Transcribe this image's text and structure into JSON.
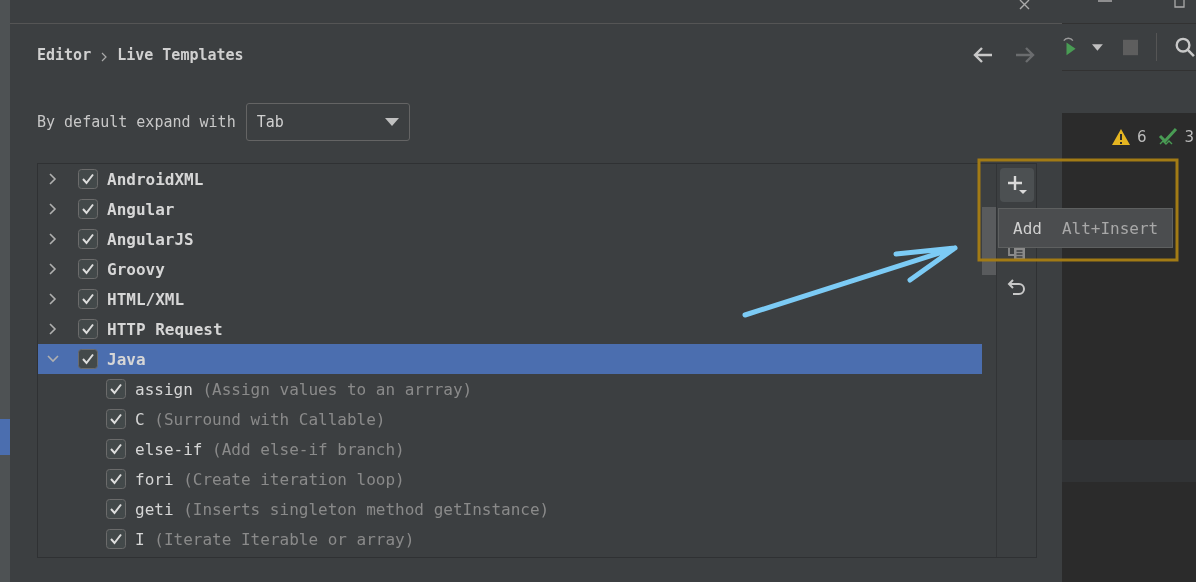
{
  "dialog": {
    "breadcrumb": [
      "Editor",
      "Live Templates"
    ],
    "expand_label": "By default expand with",
    "expand_value": "Tab",
    "groups": [
      {
        "name": "AndroidXML",
        "checked": true,
        "expanded": false,
        "selected": false
      },
      {
        "name": "Angular",
        "checked": true,
        "expanded": false,
        "selected": false
      },
      {
        "name": "AngularJS",
        "checked": true,
        "expanded": false,
        "selected": false
      },
      {
        "name": "Groovy",
        "checked": true,
        "expanded": false,
        "selected": false
      },
      {
        "name": "HTML/XML",
        "checked": true,
        "expanded": false,
        "selected": false
      },
      {
        "name": "HTTP Request",
        "checked": true,
        "expanded": false,
        "selected": false
      },
      {
        "name": "Java",
        "checked": true,
        "expanded": true,
        "selected": true,
        "children": [
          {
            "abbreviation": "assign",
            "description": "(Assign values to an arrray)",
            "checked": true
          },
          {
            "abbreviation": "C",
            "description": "(Surround with Callable)",
            "checked": true
          },
          {
            "abbreviation": "else-if",
            "description": "(Add else-if branch)",
            "checked": true
          },
          {
            "abbreviation": "fori",
            "description": "(Create iteration loop)",
            "checked": true
          },
          {
            "abbreviation": "geti",
            "description": "(Inserts singleton method getInstance)",
            "checked": true
          },
          {
            "abbreviation": "I",
            "description": "(Iterate Iterable or array)",
            "checked": true
          }
        ]
      }
    ],
    "tooltip": {
      "label": "Add",
      "shortcut": "Alt+Insert"
    }
  },
  "ide": {
    "warnings": "6",
    "checks": "3"
  }
}
